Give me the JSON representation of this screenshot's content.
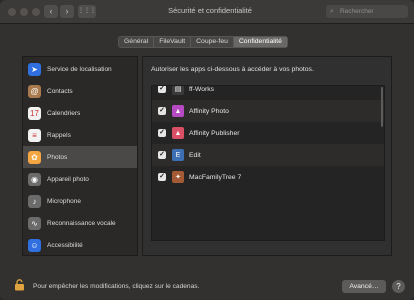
{
  "window": {
    "title": "Sécurité et confidentialité",
    "search_placeholder": "Rechercher",
    "nav_back": "‹",
    "nav_forward": "›",
    "grid": "⋮⋮⋮"
  },
  "tabs": [
    {
      "label": "Général",
      "active": false
    },
    {
      "label": "FileVault",
      "active": false
    },
    {
      "label": "Coupe-feu",
      "active": false
    },
    {
      "label": "Confidentialité",
      "active": true
    }
  ],
  "sidebar": {
    "selected": "Photos",
    "items": [
      {
        "label": "Service de localisation",
        "icon": "location-icon",
        "color": "#2f6fe0",
        "glyph": "➤"
      },
      {
        "label": "Contacts",
        "icon": "contacts-icon",
        "color": "#a97a4e",
        "glyph": "@"
      },
      {
        "label": "Calendriers",
        "icon": "calendar-icon",
        "color": "#f2f2f2",
        "glyph": "17"
      },
      {
        "label": "Rappels",
        "icon": "reminders-icon",
        "color": "#f2f2f2",
        "glyph": "≡"
      },
      {
        "label": "Photos",
        "icon": "photos-icon",
        "color": "#f4a640",
        "glyph": "✿"
      },
      {
        "label": "Appareil photo",
        "icon": "camera-icon",
        "color": "#6b6b6b",
        "glyph": "◉"
      },
      {
        "label": "Microphone",
        "icon": "microphone-icon",
        "color": "#6b6b6b",
        "glyph": "♪"
      },
      {
        "label": "Reconnaissance vocale",
        "icon": "speech-recognition-icon",
        "color": "#6b6b6b",
        "glyph": "∿"
      },
      {
        "label": "Accessibilité",
        "icon": "accessibility-icon",
        "color": "#2f6fe0",
        "glyph": "☺"
      }
    ]
  },
  "content": {
    "description": "Autoriser les apps ci-dessous à accéder à vos photos.",
    "apps": [
      {
        "label": "ff-Works",
        "checked": true,
        "icon": "ffworks-icon",
        "color": "#3a3a3a",
        "glyph": "▤"
      },
      {
        "label": "Affinity Photo",
        "checked": true,
        "icon": "affinity-photo-icon",
        "color": "#b64ac2",
        "glyph": "▲"
      },
      {
        "label": "Affinity Publisher",
        "checked": true,
        "icon": "affinity-publisher-icon",
        "color": "#d94f66",
        "glyph": "▲"
      },
      {
        "label": "Edit",
        "checked": true,
        "icon": "edit-icon",
        "color": "#3d6fb5",
        "glyph": "E"
      },
      {
        "label": "MacFamilyTree 7",
        "checked": true,
        "icon": "macfamilytree-icon",
        "color": "#a45a34",
        "glyph": "✦"
      }
    ]
  },
  "footer": {
    "lock_text": "Pour empêcher les modifications, cliquez sur le cadenas.",
    "advanced_button": "Avancé…",
    "help_button": "?"
  }
}
